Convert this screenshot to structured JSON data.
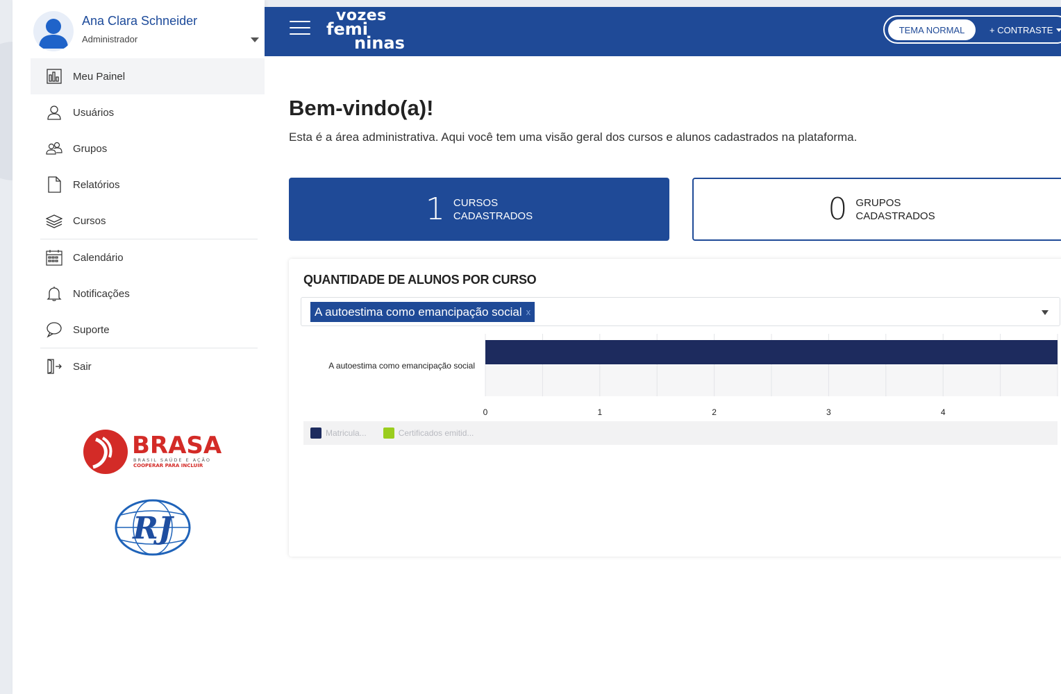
{
  "user": {
    "name": "Ana Clara Schneider",
    "role": "Administrador"
  },
  "menu": [
    {
      "label": "Meu Painel",
      "icon": "chart-panel-icon",
      "active": true
    },
    {
      "label": "Usuários",
      "icon": "user-icon"
    },
    {
      "label": "Grupos",
      "icon": "group-icon"
    },
    {
      "label": "Relatórios",
      "icon": "document-icon"
    },
    {
      "label": "Cursos",
      "icon": "layers-icon"
    },
    {
      "label": "Calendário",
      "icon": "calendar-icon"
    },
    {
      "label": "Notificações",
      "icon": "bell-icon"
    },
    {
      "label": "Suporte",
      "icon": "chat-icon"
    },
    {
      "label": "Sair",
      "icon": "logout-icon"
    }
  ],
  "logos": {
    "brasa_name": "BRASA",
    "brasa_line1": "BRASIL SAÚDE E AÇÃO",
    "brasa_line2": "COOPERAR PARA INCLUIR",
    "rj": "RJ"
  },
  "brand": {
    "line1": "vozes",
    "line2": "femi",
    "line3": "ninas"
  },
  "header": {
    "theme_normal": "TEMA NORMAL",
    "theme_contrast": "+ CONTRASTE"
  },
  "welcome": {
    "title": "Bem-vindo(a)!",
    "subtitle": "Esta é a área administrativa. Aqui você tem uma visão geral dos cursos e alunos cadastrados na plataforma."
  },
  "stats": [
    {
      "value": "1",
      "label1": "CURSOS",
      "label2": "CADASTRADOS"
    },
    {
      "value": "0",
      "label1": "GRUPOS",
      "label2": "CADASTRADOS"
    }
  ],
  "chart_panel": {
    "title": "QUANTIDADE DE ALUNOS POR CURSO",
    "selected_course": "A autoestima como emancipação social",
    "remove_tag": "x"
  },
  "colors": {
    "primary": "#1f4a97",
    "bar": "#1d2b5e",
    "certificados": "#9acd1e"
  },
  "chart_data": {
    "type": "bar",
    "orientation": "horizontal",
    "categories": [
      "A autoestima como emancipação social"
    ],
    "series": [
      {
        "name": "Matricula...",
        "values": [
          5
        ],
        "color": "#1d2b5e"
      },
      {
        "name": "Certificados emitid...",
        "values": [
          0
        ],
        "color": "#9acd1e"
      }
    ],
    "xticks": [
      0,
      1,
      2,
      3,
      4
    ],
    "xlim": [
      0,
      5
    ],
    "grid": true,
    "legend": "bottom-left"
  }
}
